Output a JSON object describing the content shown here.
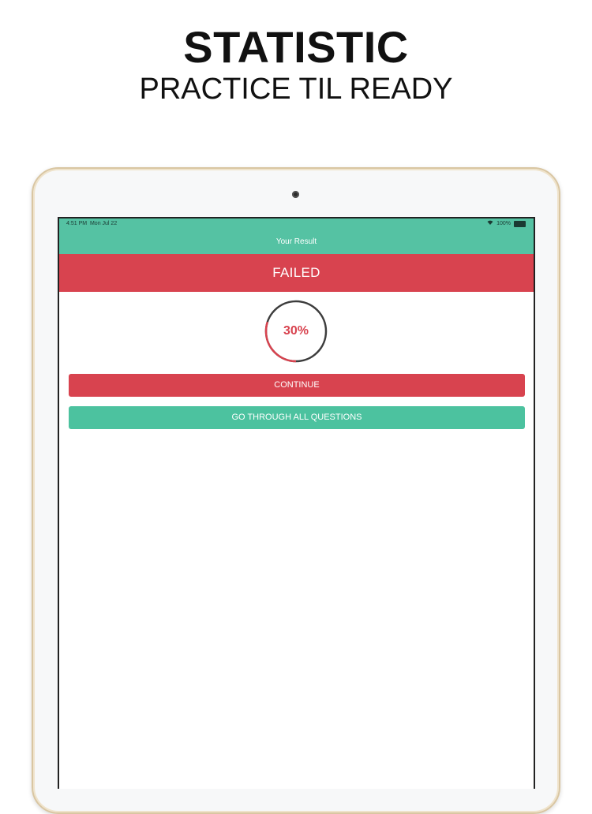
{
  "promo": {
    "title": "STATISTIC",
    "subtitle": "PRACTICE TIL READY"
  },
  "status_bar": {
    "time": "4:51 PM",
    "date": "Mon Jul 22",
    "battery": "100%",
    "icons": [
      "wifi-icon",
      "battery-icon"
    ]
  },
  "nav": {
    "title": "Your Result"
  },
  "result": {
    "status": "FAILED",
    "score_label": "30%",
    "score_fraction": 0.3
  },
  "buttons": {
    "continue_label": "CONTINUE",
    "review_label": "GO THROUGH ALL QUESTIONS"
  },
  "colors": {
    "teal": "#55c2a3",
    "red": "#d8434f",
    "device_frame": "#d9c6a2"
  }
}
